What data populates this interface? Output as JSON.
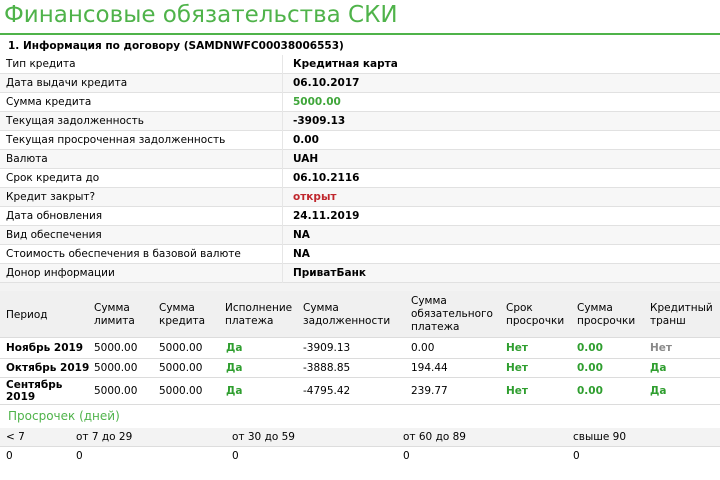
{
  "page": {
    "title": "Финансовые обязательства СКИ",
    "section_title": "1. Информация по договору (SAMDNWFC00038006553)"
  },
  "contract_info": [
    {
      "label": "Тип кредита",
      "value": "Кредитная карта",
      "style": "normal"
    },
    {
      "label": "Дата выдачи кредита",
      "value": "06.10.2017",
      "style": "normal"
    },
    {
      "label": "Сумма кредита",
      "value": "5000.00",
      "style": "green"
    },
    {
      "label": "Текущая задолженность",
      "value": "-3909.13",
      "style": "normal"
    },
    {
      "label": "Текущая просроченная задолженность",
      "value": "0.00",
      "style": "normal"
    },
    {
      "label": "Валюта",
      "value": "UAH",
      "style": "normal"
    },
    {
      "label": "Срок кредита до",
      "value": "06.10.2116",
      "style": "normal"
    },
    {
      "label": "Кредит закрыт?",
      "value": "открыт",
      "style": "red"
    },
    {
      "label": "Дата обновления",
      "value": "24.11.2019",
      "style": "normal"
    },
    {
      "label": "Вид обеспечения",
      "value": "NA",
      "style": "normal"
    },
    {
      "label": "Стоимость обеспечения в базовой валюте",
      "value": "NA",
      "style": "normal"
    },
    {
      "label": "Донор информации",
      "value": "ПриватБанк",
      "style": "normal"
    }
  ],
  "history": {
    "columns": [
      "Период",
      "Сумма лимита",
      "Сумма кредита",
      "Исполнение платежа",
      "Сумма задолженности",
      "Сумма обязательного платежа",
      "Срок просрочки",
      "Сумма просрочки",
      "Кредитный транш"
    ],
    "rows": [
      {
        "period": "Ноябрь 2019",
        "limit": "5000.00",
        "credit": "5000.00",
        "payment": "Да",
        "debt": "-3909.13",
        "mandatory": "0.00",
        "overdue_term": "Нет",
        "overdue_sum": "0.00",
        "tranche": "Нет"
      },
      {
        "period": "Октябрь 2019",
        "limit": "5000.00",
        "credit": "5000.00",
        "payment": "Да",
        "debt": "-3888.85",
        "mandatory": "194.44",
        "overdue_term": "Нет",
        "overdue_sum": "0.00",
        "tranche": "Да"
      },
      {
        "period": "Сентябрь 2019",
        "limit": "5000.00",
        "credit": "5000.00",
        "payment": "Да",
        "debt": "-4795.42",
        "mandatory": "239.77",
        "overdue_term": "Нет",
        "overdue_sum": "0.00",
        "tranche": "Да"
      }
    ]
  },
  "overdue": {
    "title": "Просрочек (дней)",
    "headers": [
      "< 7",
      "от 7 до 29",
      "от 30 до 59",
      "от 60 до 89",
      "свыше 90"
    ],
    "values": [
      "0",
      "0",
      "0",
      "0",
      "0"
    ]
  },
  "colors": {
    "accent": "#4fb34a",
    "positive": "#2f9e2f",
    "negative": "#c0272d",
    "muted": "#8a8a8a"
  }
}
